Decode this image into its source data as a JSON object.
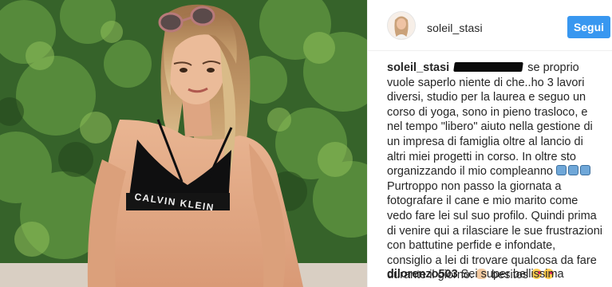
{
  "post": {
    "username": "soleil_stasi",
    "follow_label": "Segui",
    "colors": {
      "follow_button": "#3897f0",
      "text": "#262626"
    }
  },
  "caption": {
    "user": "soleil_stasi",
    "text_a": "se proprio vuole saperlo niente di che..ho 3 lavori diversi, studio per la laurea e seguo un corso di yoga, sono in pieno trasloco, e nel tempo \"libero\" aiuto nella gestione di un impresa di famiglia oltre al lancio di altri miei progetti in corso. In oltre sto organizzando il mio compleanno",
    "text_b": "Purtroppo non passo la giornata a fotografare il cane e mio marito come vedo fare lei sul suo profilo. Quindi prima di venire qui a rilasciare le sue frustrazioni con battutine perfide e infondate, consiglio a lei di trovare qualcosa da fare durante il giorno.",
    "text_c": "besitos",
    "emoji": [
      "raised-hands-icon",
      "kiss-face-icon"
    ]
  },
  "comments": [
    {
      "user": "dilorenzo503",
      "text": "Sei super bellissima"
    }
  ]
}
